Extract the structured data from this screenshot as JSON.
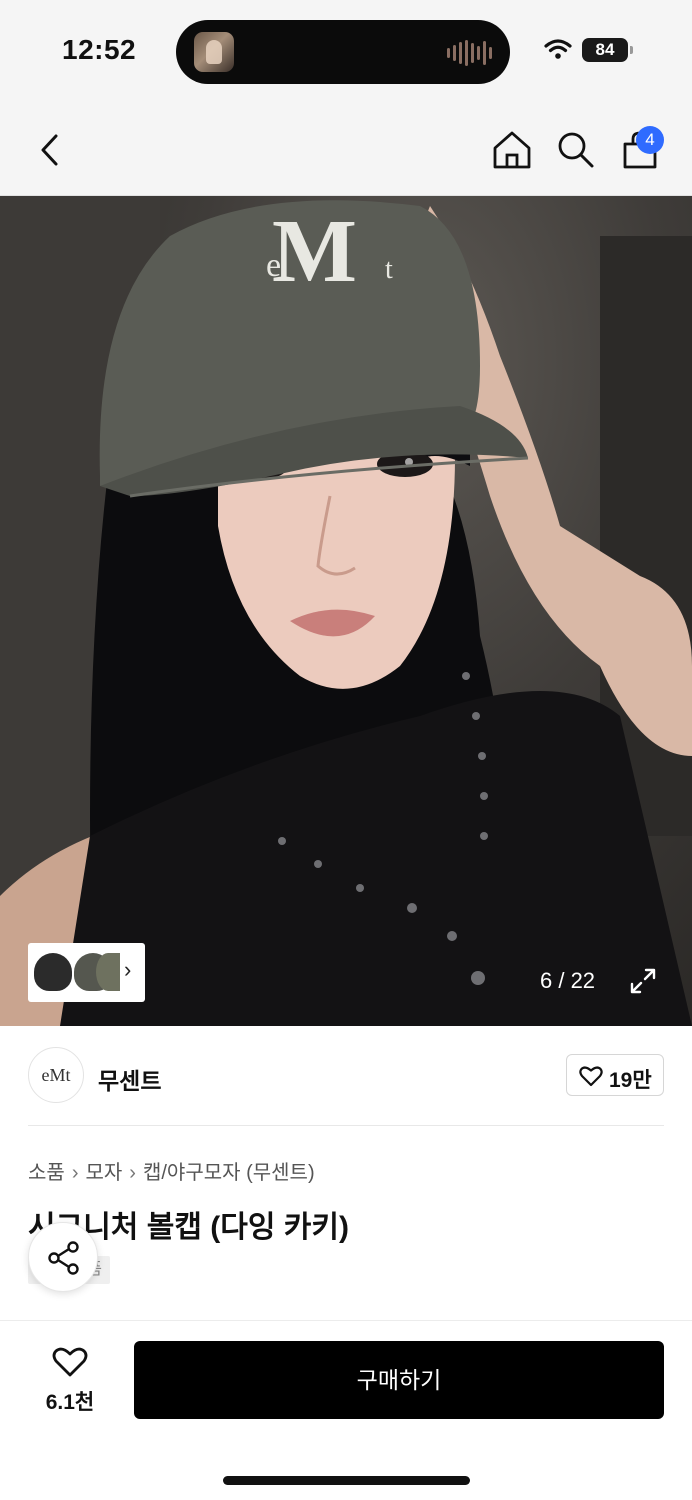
{
  "status": {
    "time": "12:52",
    "battery": "84"
  },
  "nav": {
    "cart_count": "4"
  },
  "gallery": {
    "counter": "6 / 22",
    "hat_logo": "eMt"
  },
  "brand": {
    "name": "무센트",
    "logo_text": "eMt",
    "likes": "19만"
  },
  "breadcrumb": [
    "소품",
    "모자",
    "캡/야구모자 (무센트)"
  ],
  "product": {
    "title": "시그니처 볼캡 (다잉 카키)",
    "tag": "품"
  },
  "actions": {
    "wish_count": "6.1천",
    "buy_label": "구매하기"
  },
  "colors": {
    "accent": "#2f6bff",
    "buy_bg": "#000000",
    "cap": "#5a5c55"
  },
  "icons": [
    "back-icon",
    "home-icon",
    "search-icon",
    "shopping-bag-icon",
    "expand-icon",
    "heart-icon",
    "share-icon",
    "chevron-right-icon"
  ]
}
